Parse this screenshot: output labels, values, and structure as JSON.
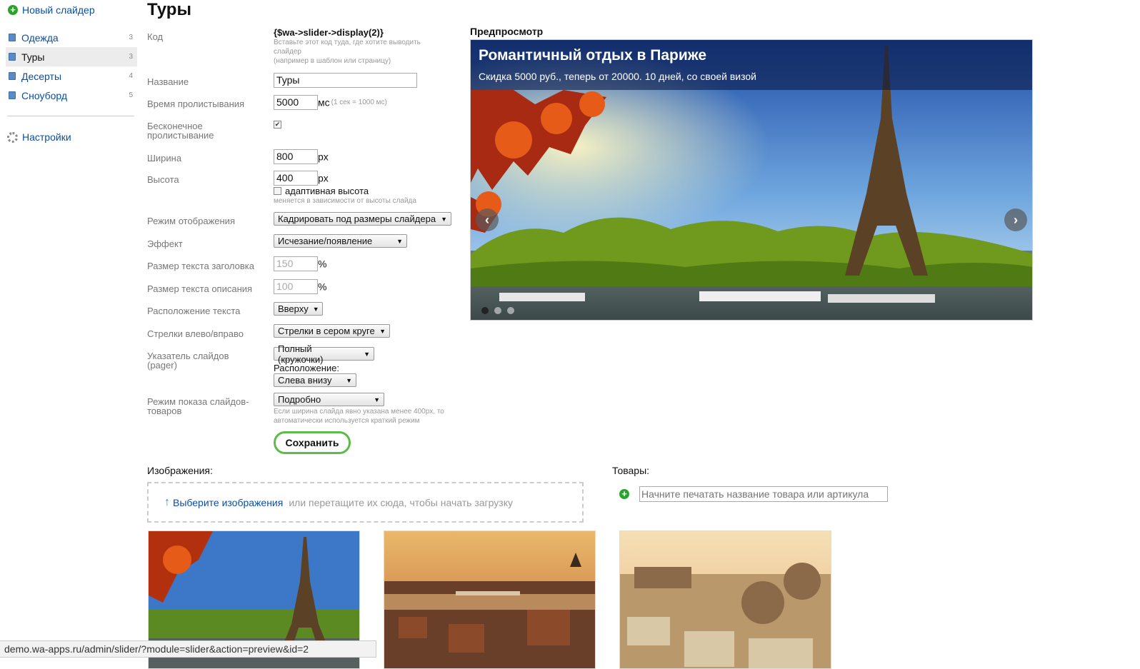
{
  "sidebar": {
    "new_slider": "Новый слайдер",
    "items": [
      {
        "label": "Одежда",
        "count": "3"
      },
      {
        "label": "Туры",
        "count": "3"
      },
      {
        "label": "Десерты",
        "count": "4"
      },
      {
        "label": "Сноуборд",
        "count": "5"
      }
    ],
    "active_index": 1,
    "settings": "Настройки"
  },
  "page": {
    "title": "Туры"
  },
  "form": {
    "code": {
      "label": "Код",
      "value": "{$wa->slider->display(2)}",
      "hint1": "Вставьте этот код туда, где хотите выводить слайдер",
      "hint2": "(например в шаблон или страницу)"
    },
    "name": {
      "label": "Название",
      "value": "Туры"
    },
    "scroll_time": {
      "label": "Время пролистывания",
      "value": "5000",
      "unit": "мс",
      "hint": "(1 сек = 1000 мс)"
    },
    "infinite": {
      "label": "Бесконечное пролистывание",
      "checked": true
    },
    "width": {
      "label": "Ширина",
      "value": "800",
      "unit": "px"
    },
    "height": {
      "label": "Высота",
      "value": "400",
      "unit": "px",
      "adaptive_label": "адаптивная высота",
      "adaptive_checked": false,
      "hint": "меняется в зависимости от высоты слайда"
    },
    "display_mode": {
      "label": "Режим отображения",
      "value": "Кадрировать под размеры слайдера"
    },
    "effect": {
      "label": "Эффект",
      "value": "Исчезание/появление"
    },
    "title_size": {
      "label": "Размер текста заголовка",
      "placeholder": "150",
      "unit": "%"
    },
    "desc_size": {
      "label": "Размер текста описания",
      "placeholder": "100",
      "unit": "%"
    },
    "text_position": {
      "label": "Расположение текста",
      "value": "Вверху"
    },
    "arrows": {
      "label": "Стрелки влево/вправо",
      "value": "Стрелки в сером круге"
    },
    "pager": {
      "label": "Указатель слайдов (pager)",
      "value": "Полный (кружочки)",
      "position_label": "Расположение:",
      "position_value": "Слева внизу"
    },
    "products_mode": {
      "label": "Режим показа слайдов-товаров",
      "value": "Подробно",
      "hint": "Если ширина слайда явно указана менее 400px, то автоматически используется краткий режим"
    },
    "save": "Сохранить"
  },
  "preview": {
    "title": "Предпросмотр",
    "slide_title": "Романтичный отдых в Париже",
    "slide_desc": "Скидка 5000 руб., теперь от 20000. 10 дней, со своей визой",
    "prev_icon": "‹",
    "next_icon": "›",
    "dots": 3,
    "active_dot": 0
  },
  "images": {
    "title": "Изображения:",
    "upload_link": "Выберите изображения",
    "upload_hint": "или перетащите их сюда, чтобы начать загрузку"
  },
  "products": {
    "title": "Товары:",
    "placeholder": "Начните печатать название товара или артикула"
  },
  "statusbar": "demo.wa-apps.ru/admin/slider/?module=slider&action=preview&id=2",
  "colors": {
    "link": "#0a4fa0",
    "save_border": "#5cbc4a",
    "add_green": "#2aa32a"
  }
}
